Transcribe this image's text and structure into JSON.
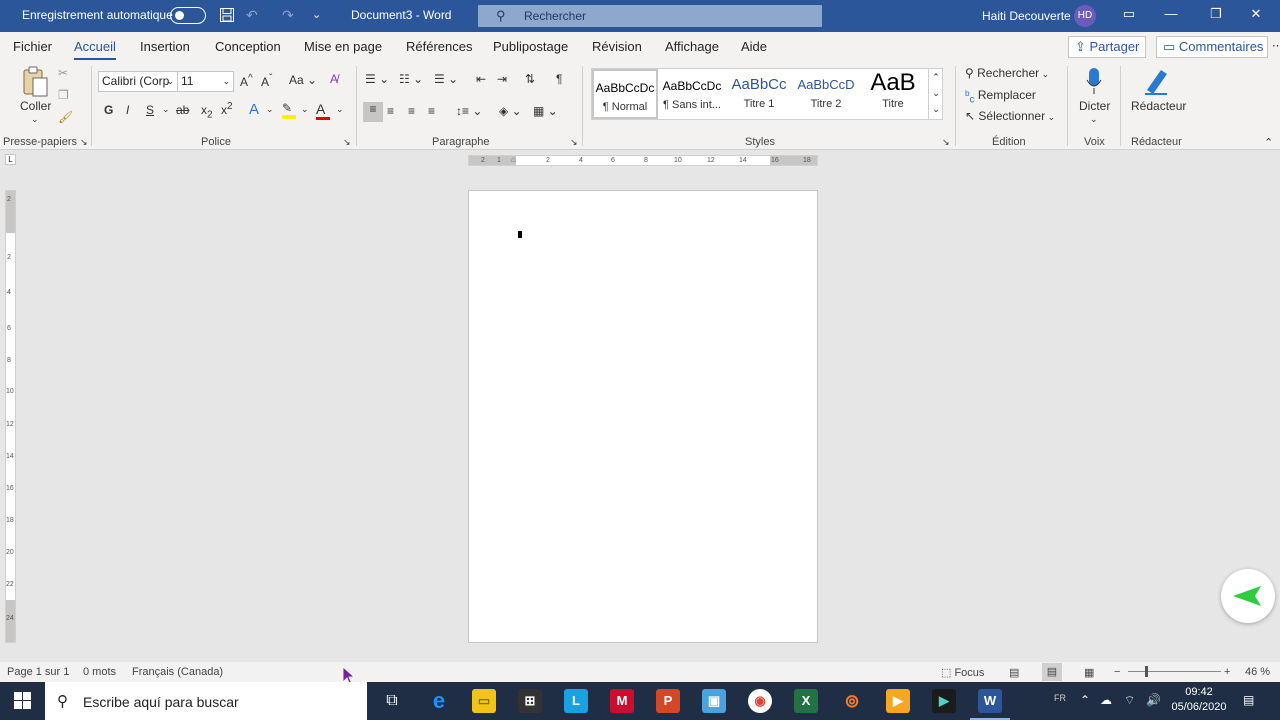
{
  "titlebar": {
    "autosave_label": "Enregistrement automatique",
    "document_title": "Document3  -  Word",
    "search_placeholder": "Rechercher",
    "user_name": "Haiti Decouverte",
    "user_initials": "HD"
  },
  "menu": {
    "tabs": [
      "Fichier",
      "Accueil",
      "Insertion",
      "Conception",
      "Mise en page",
      "Références",
      "Publipostage",
      "Révision",
      "Affichage",
      "Aide"
    ],
    "active_tab": "Accueil",
    "share_label": "Partager",
    "comments_label": "Commentaires"
  },
  "ribbon": {
    "clipboard": {
      "paste_label": "Coller",
      "group_label": "Presse-papiers"
    },
    "font": {
      "font_name": "Calibri (Corp",
      "font_size": "11",
      "bold": "G",
      "italic": "I",
      "underline": "S",
      "strike": "ab",
      "group_label": "Police",
      "case_label": "Aa"
    },
    "paragraph": {
      "group_label": "Paragraphe"
    },
    "styles": {
      "group_label": "Styles",
      "items": [
        {
          "preview": "AaBbCcDc",
          "label": "¶ Normal"
        },
        {
          "preview": "AaBbCcDc",
          "label": "¶ Sans int..."
        },
        {
          "preview": "AaBbCc",
          "label": "Titre 1"
        },
        {
          "preview": "AaBbCcD",
          "label": "Titre 2"
        },
        {
          "preview": "AaB",
          "label": "Titre"
        }
      ]
    },
    "editing": {
      "find_label": "Rechercher",
      "replace_label": "Remplacer",
      "select_label": "Sélectionner",
      "group_label": "Édition"
    },
    "voice": {
      "dictate_label": "Dicter",
      "group_label": "Voix"
    },
    "editor": {
      "editor_label": "Rédacteur",
      "group_label": "Rédacteur"
    }
  },
  "ruler": {
    "h_ticks": [
      "2",
      "1",
      "2",
      "4",
      "6",
      "8",
      "10",
      "12",
      "14",
      "16",
      "18"
    ],
    "v_ticks": [
      "2",
      "2",
      "4",
      "6",
      "8",
      "10",
      "12",
      "14",
      "16",
      "18",
      "20",
      "22",
      "24"
    ]
  },
  "statusbar": {
    "page": "Page 1 sur 1",
    "words": "0 mots",
    "language": "Français (Canada)",
    "focus": "Focus",
    "zoom": "46 %"
  },
  "taskbar": {
    "search_placeholder": "Escribe aquí para buscar",
    "tray_lang": "FR",
    "time": "09:42",
    "date": "05/06/2020"
  },
  "colors": {
    "word_blue": "#2b579a",
    "ribbon_bg": "#f3f2f1",
    "taskbar_bg": "#1f2e44"
  }
}
